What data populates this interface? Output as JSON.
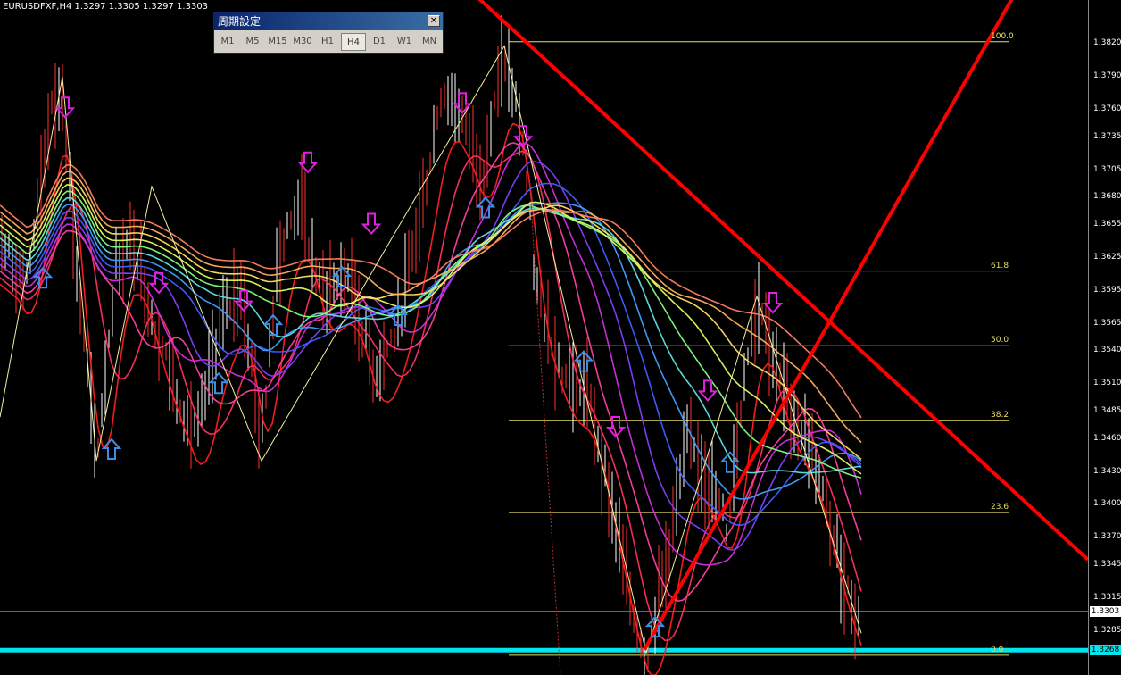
{
  "header": {
    "symbol_info": "EURUSDFXF,H4  1.3297 1.3305 1.3297 1.3303"
  },
  "period_panel": {
    "title": "周期設定",
    "close_glyph": "✕",
    "buttons": [
      "M1",
      "M5",
      "M15",
      "M30",
      "H1",
      "H4",
      "D1",
      "W1",
      "MN"
    ],
    "active": "H4"
  },
  "current_price": {
    "label": "1.3303",
    "color": "#ffffff"
  },
  "low_price": {
    "label": "1.3268",
    "color": "#00e5ee"
  },
  "chart_data": {
    "type": "line",
    "ylim": [
      1.3245,
      1.386
    ],
    "y_ticks": [
      "1.3820",
      "1.3790",
      "1.3760",
      "1.3735",
      "1.3705",
      "1.3680",
      "1.3655",
      "1.3625",
      "1.3595",
      "1.3565",
      "1.3540",
      "1.3510",
      "1.3485",
      "1.3460",
      "1.3430",
      "1.3400",
      "1.3370",
      "1.3345",
      "1.3315",
      "1.3285"
    ],
    "fib_levels": [
      {
        "label": "100.0",
        "price": 1.3822
      },
      {
        "label": "61.8",
        "price": 1.3613
      },
      {
        "label": "50.0",
        "price": 1.3545
      },
      {
        "label": "38.2",
        "price": 1.3477
      },
      {
        "label": "23.6",
        "price": 1.3393
      },
      {
        "label": "0.0",
        "price": 1.3263
      }
    ],
    "ma_colors": [
      "#ff2020",
      "#ff3060",
      "#ff40a0",
      "#d030e0",
      "#8040ff",
      "#4060ff",
      "#40a0ff",
      "#60e0e0",
      "#80ff80",
      "#e0ff60",
      "#ffe060",
      "#ffb060",
      "#ff8060"
    ],
    "zigzag": [
      [
        0,
        1.348
      ],
      [
        70,
        1.379
      ],
      [
        108,
        1.344
      ],
      [
        170,
        1.369
      ],
      [
        293,
        1.344
      ],
      [
        565,
        1.3818
      ],
      [
        724,
        1.3265
      ],
      [
        848,
        1.359
      ],
      [
        965,
        1.3283
      ]
    ],
    "price_path": [
      [
        0,
        1.364
      ],
      [
        30,
        1.36
      ],
      [
        55,
        1.375
      ],
      [
        70,
        1.378
      ],
      [
        85,
        1.362
      ],
      [
        108,
        1.344
      ],
      [
        130,
        1.362
      ],
      [
        150,
        1.364
      ],
      [
        175,
        1.356
      ],
      [
        200,
        1.35
      ],
      [
        220,
        1.346
      ],
      [
        245,
        1.356
      ],
      [
        270,
        1.36
      ],
      [
        293,
        1.346
      ],
      [
        310,
        1.362
      ],
      [
        335,
        1.368
      ],
      [
        360,
        1.359
      ],
      [
        390,
        1.361
      ],
      [
        420,
        1.352
      ],
      [
        445,
        1.356
      ],
      [
        470,
        1.366
      ],
      [
        495,
        1.378
      ],
      [
        515,
        1.376
      ],
      [
        540,
        1.37
      ],
      [
        565,
        1.381
      ],
      [
        585,
        1.374
      ],
      [
        600,
        1.36
      ],
      [
        630,
        1.352
      ],
      [
        660,
        1.35
      ],
      [
        690,
        1.338
      ],
      [
        710,
        1.33
      ],
      [
        724,
        1.3265
      ],
      [
        745,
        1.334
      ],
      [
        770,
        1.346
      ],
      [
        795,
        1.342
      ],
      [
        815,
        1.338
      ],
      [
        835,
        1.353
      ],
      [
        850,
        1.359
      ],
      [
        870,
        1.352
      ],
      [
        890,
        1.348
      ],
      [
        910,
        1.345
      ],
      [
        930,
        1.338
      ],
      [
        950,
        1.332
      ],
      [
        965,
        1.329
      ]
    ],
    "up_arrows": [
      [
        48,
        1.3606
      ],
      [
        125,
        1.345
      ],
      [
        245,
        1.351
      ],
      [
        306,
        1.3563
      ],
      [
        383,
        1.3607
      ],
      [
        446,
        1.3572
      ],
      [
        544,
        1.367
      ],
      [
        654,
        1.353
      ],
      [
        734,
        1.3288
      ],
      [
        818,
        1.3438
      ]
    ],
    "down_arrows": [
      [
        73,
        1.3763
      ],
      [
        178,
        1.3603
      ],
      [
        273,
        1.3587
      ],
      [
        345,
        1.3713
      ],
      [
        416,
        1.3657
      ],
      [
        518,
        1.3767
      ],
      [
        586,
        1.3737
      ],
      [
        690,
        1.3472
      ],
      [
        793,
        1.3505
      ],
      [
        866,
        1.3585
      ]
    ],
    "trendlines": [
      {
        "from": [
          525,
          1.387
        ],
        "to": [
          1219,
          1.335
        ],
        "color": "#ff0000"
      },
      {
        "from": [
          722,
          1.3268
        ],
        "to": [
          1140,
          1.387
        ],
        "color": "#ff0000"
      }
    ]
  }
}
